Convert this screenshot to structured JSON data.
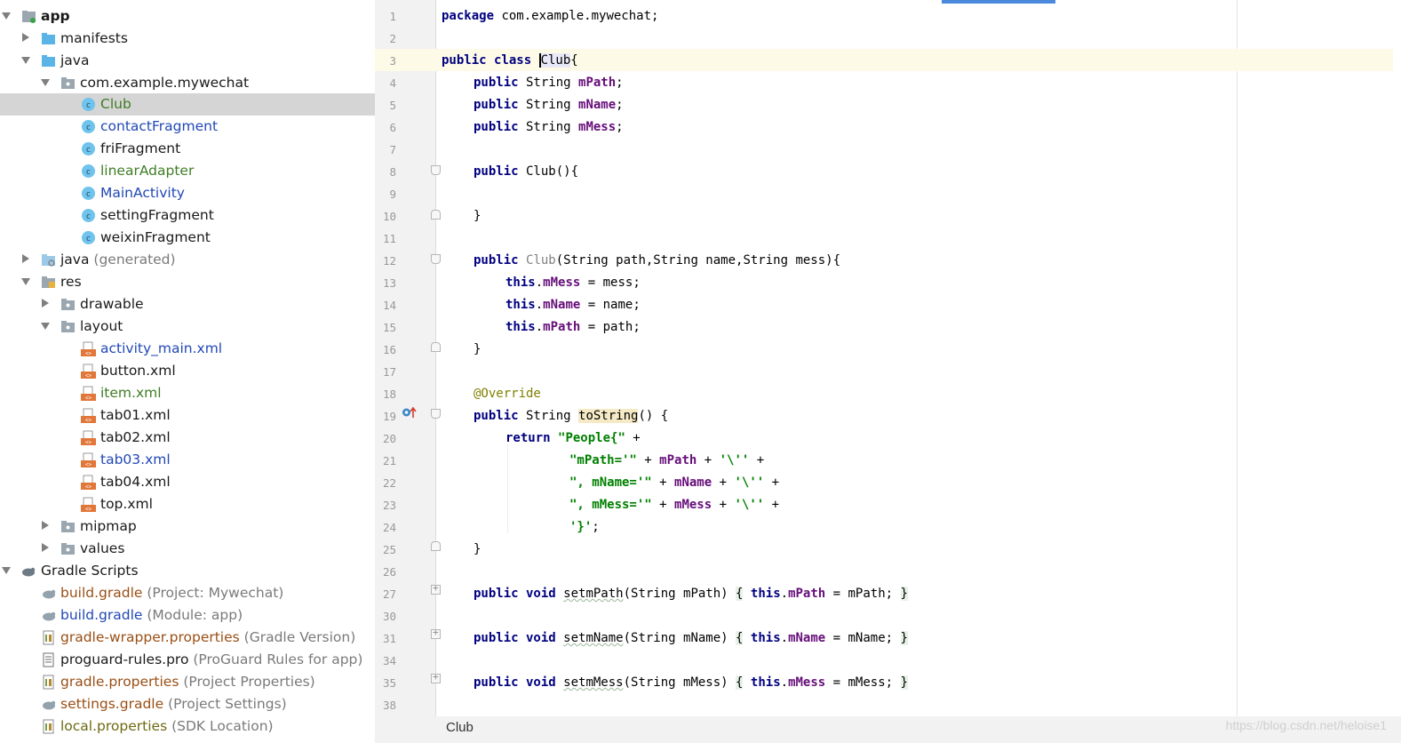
{
  "project_tree": {
    "items": [
      {
        "label": "app",
        "suffix": "",
        "color": "#1a1a1a"
      },
      {
        "label": "manifests",
        "suffix": ""
      },
      {
        "label": "java",
        "suffix": ""
      },
      {
        "label": "com.example.mywechat",
        "suffix": ""
      },
      {
        "label": "Club",
        "suffix": ""
      },
      {
        "label": "contactFragment",
        "suffix": ""
      },
      {
        "label": "friFragment",
        "suffix": ""
      },
      {
        "label": "linearAdapter",
        "suffix": ""
      },
      {
        "label": "MainActivity",
        "suffix": ""
      },
      {
        "label": "settingFragment",
        "suffix": ""
      },
      {
        "label": "weixinFragment",
        "suffix": ""
      },
      {
        "label": "java",
        "suffix": " (generated)"
      },
      {
        "label": "res",
        "suffix": ""
      },
      {
        "label": "drawable",
        "suffix": ""
      },
      {
        "label": "layout",
        "suffix": ""
      },
      {
        "label": "activity_main.xml",
        "suffix": ""
      },
      {
        "label": "button.xml",
        "suffix": ""
      },
      {
        "label": "item.xml",
        "suffix": ""
      },
      {
        "label": "tab01.xml",
        "suffix": ""
      },
      {
        "label": "tab02.xml",
        "suffix": ""
      },
      {
        "label": "tab03.xml",
        "suffix": ""
      },
      {
        "label": "tab04.xml",
        "suffix": ""
      },
      {
        "label": "top.xml",
        "suffix": ""
      },
      {
        "label": "mipmap",
        "suffix": ""
      },
      {
        "label": "values",
        "suffix": ""
      },
      {
        "label": "Gradle Scripts",
        "suffix": ""
      },
      {
        "label": "build.gradle",
        "suffix": " (Project: Mywechat)"
      },
      {
        "label": "build.gradle",
        "suffix": " (Module: app)"
      },
      {
        "label": "gradle-wrapper.properties",
        "suffix": " (Gradle Version)"
      },
      {
        "label": "proguard-rules.pro",
        "suffix": " (ProGuard Rules for app)"
      },
      {
        "label": "gradle.properties",
        "suffix": " (Project Properties)"
      },
      {
        "label": "settings.gradle",
        "suffix": " (Project Settings)"
      },
      {
        "label": "local.properties",
        "suffix": " (SDK Location)"
      }
    ]
  },
  "editor": {
    "line_numbers": [
      "1",
      "2",
      "3",
      "4",
      "5",
      "6",
      "7",
      "8",
      "9",
      "10",
      "11",
      "12",
      "13",
      "14",
      "15",
      "16",
      "17",
      "18",
      "19",
      "20",
      "21",
      "22",
      "23",
      "24",
      "25",
      "26",
      "27",
      "30",
      "31",
      "34",
      "35",
      "38"
    ],
    "code": {
      "l1_kw": "package",
      "l1_rest": " com.example.mywechat;",
      "l3_kw": "public class ",
      "l3_cls": "Club",
      "l3_rest": "{",
      "kw_public": "public",
      "kw_this": "this",
      "type_string": " String ",
      "f_mPath": "mPath",
      "f_mName": "mName",
      "f_mMess": "mMess",
      "semicolon": ";",
      "l8_rest": " Club(){",
      "close_brace": "}",
      "l12_cls": "Club",
      "l12_rest": "(String path,String name,String mess){",
      "eq_mess": " = mess;",
      "eq_name": " = name;",
      "eq_path": " = path;",
      "dot": ".",
      "annotation": "@Override",
      "l19_method": "toString",
      "l19_rest": "() {",
      "kw_return": "return",
      "s_people": "\"People{\"",
      "plus": " +",
      "s_mpath": "\"mPath='\"",
      "s_mname": "\", mName='\"",
      "s_mmess": "\", mMess='\"",
      "s_quote": "'\\''",
      "s_end": "'}'",
      "mid_plus": " + ",
      "kw_void": " void ",
      "m_setmPath": "setmPath",
      "p_setmPath": "(String mPath) ",
      "m_setmName": "setmName",
      "p_setmName": "(String mName) ",
      "m_setmMess": "setmMess",
      "p_setmMess": "(String mMess) ",
      "open_fold": "{",
      "close_fold": "}",
      "eq_mPath": " = mPath; ",
      "eq_mName": " = mName; ",
      "eq_mMess": " = mMess; "
    }
  },
  "statusbar": {
    "breadcrumb": "Club",
    "watermark": "https://blog.csdn.net/heloise1"
  },
  "colors": {
    "keyword": "#000080",
    "field": "#660e7a",
    "string": "#008000",
    "annotation": "#808000",
    "selection": "#d5d5d5",
    "current_line": "#fdfbe7"
  }
}
